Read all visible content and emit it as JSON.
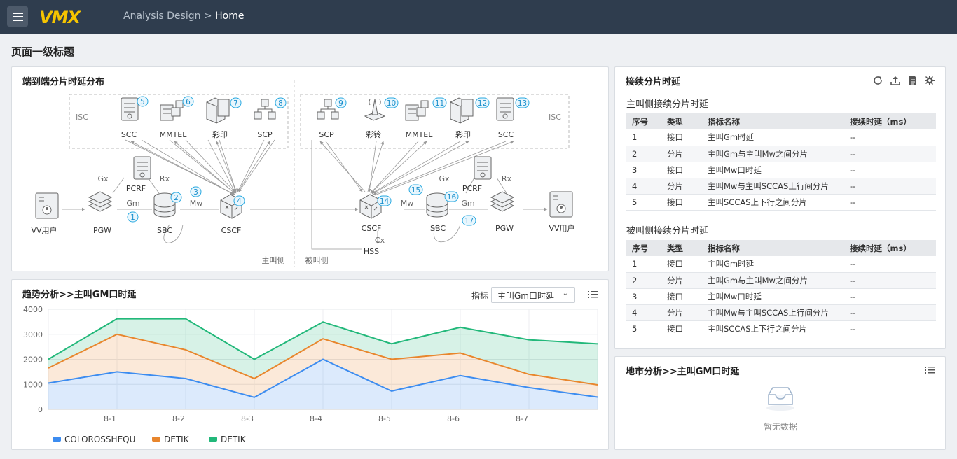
{
  "header": {
    "logo": "VMX",
    "breadcrumb_parent": "Analysis Design",
    "breadcrumb_sep": " > ",
    "breadcrumb_current": "Home"
  },
  "page_title": "页面一级标题",
  "topology": {
    "title": "端到端分片时延分布",
    "isc": "ISC",
    "caller_side": "主叫侧",
    "callee_side": "被叫侧",
    "nodes": {
      "vv_left": "VV用户",
      "pgw_left": "PGW",
      "pcrf_left": "PCRF",
      "sbc_left": "SBC",
      "cscf_left": "CSCF",
      "scc_left": "SCC",
      "mmtel_left": "MMTEL",
      "cy_left": "彩印",
      "scp_left": "SCP",
      "scp_right": "SCP",
      "cl_right": "彩铃",
      "mmtel_right": "MMTEL",
      "cy_right": "彩印",
      "scc_right": "SCC",
      "cscf_right": "CSCF",
      "hss": "HSS",
      "sbc_right": "SBC",
      "pcrf_right": "PCRF",
      "pgw_right": "PGW",
      "vv_right": "VV用户"
    },
    "links": {
      "gx": "Gx",
      "rx": "Rx",
      "gm": "Gm",
      "mw": "Mw",
      "cx": "Cx"
    },
    "badges": [
      "1",
      "2",
      "3",
      "4",
      "5",
      "6",
      "7",
      "8",
      "9",
      "10",
      "11",
      "12",
      "13",
      "14",
      "15",
      "16",
      "17"
    ]
  },
  "trend": {
    "title": "趋势分析>>主叫GM口时延",
    "metric_label": "指标",
    "metric_value": "主叫Gm口时延",
    "colors": {
      "blue": "#3c8cf0",
      "orange": "#e8862d",
      "green": "#22b87a"
    }
  },
  "chart_data": {
    "type": "area",
    "categories": [
      "8-1",
      "8-2",
      "8-3",
      "8-4",
      "8-5",
      "8-6",
      "8-7"
    ],
    "x": [
      0,
      1,
      2,
      3,
      4,
      5,
      6,
      7,
      8
    ],
    "ylim": [
      0,
      4000
    ],
    "yticks": [
      "0",
      "1000",
      "2000",
      "3000",
      "4000"
    ],
    "series": [
      {
        "name": "COLOROSSHEQU",
        "values": [
          1050,
          1500,
          1230,
          480,
          2000,
          730,
          1350,
          870,
          490
        ]
      },
      {
        "name": "DETIK",
        "values": [
          1650,
          3000,
          2380,
          1230,
          2820,
          2000,
          2250,
          1400,
          980
        ]
      },
      {
        "name": "DETIK",
        "values": [
          2000,
          3620,
          3620,
          2000,
          3490,
          2620,
          3280,
          2780,
          2620
        ]
      }
    ],
    "grid": true,
    "legend_position": "bottom-left"
  },
  "latency": {
    "title": "接续分片时延",
    "caller_title": "主叫侧接续分片时延",
    "callee_title": "被叫侧接续分片时延",
    "headers": [
      "序号",
      "类型",
      "指标名称",
      "接续时延（ms）"
    ],
    "caller_rows": [
      [
        "1",
        "接口",
        "主叫Gm时延",
        "--"
      ],
      [
        "2",
        "分片",
        "主叫Gm与主叫Mw之间分片",
        "--"
      ],
      [
        "3",
        "接口",
        "主叫Mw口时延",
        "--"
      ],
      [
        "4",
        "分片",
        "主叫Mw与主叫SCCAS上行间分片",
        "--"
      ],
      [
        "5",
        "接口",
        "主叫SCCAS上下行之间分片",
        "--"
      ]
    ],
    "callee_rows": [
      [
        "1",
        "接口",
        "主叫Gm时延",
        "--"
      ],
      [
        "2",
        "分片",
        "主叫Gm与主叫Mw之间分片",
        "--"
      ],
      [
        "3",
        "接口",
        "主叫Mw口时延",
        "--"
      ],
      [
        "4",
        "分片",
        "主叫Mw与主叫SCCAS上行间分片",
        "--"
      ],
      [
        "5",
        "接口",
        "主叫SCCAS上下行之间分片",
        "--"
      ]
    ]
  },
  "region": {
    "title": "地市分析>>主叫GM口时延",
    "empty_text": "暂无数据"
  }
}
